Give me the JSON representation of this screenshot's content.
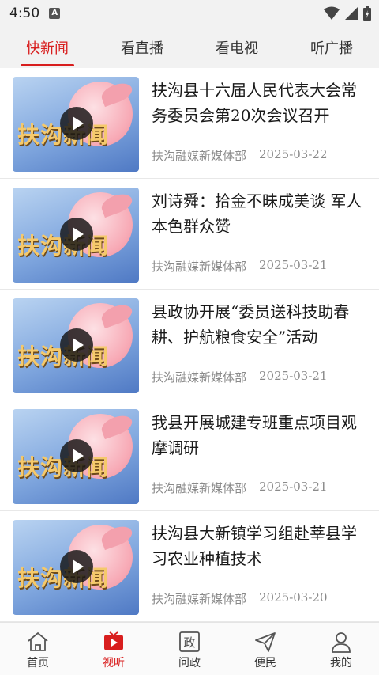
{
  "status_bar": {
    "time": "4:50",
    "badge": "A"
  },
  "top_tabs": [
    {
      "label": "快新闻",
      "active": true
    },
    {
      "label": "看直播",
      "active": false
    },
    {
      "label": "看电视",
      "active": false
    },
    {
      "label": "听广播",
      "active": false
    }
  ],
  "thumbnail_text": "扶沟新闻",
  "news": [
    {
      "title": "扶沟县十六届人民代表大会常务委员会第20次会议召开",
      "source": "扶沟融媒新媒体部",
      "date": "2025-03-22"
    },
    {
      "title": "刘诗舜：拾金不昧成美谈 军人本色群众赞",
      "source": "扶沟融媒新媒体部",
      "date": "2025-03-21"
    },
    {
      "title": "县政协开展“委员送科技助春耕、护航粮食安全”活动",
      "source": "扶沟融媒新媒体部",
      "date": "2025-03-21"
    },
    {
      "title": "我县开展城建专班重点项目观摩调研",
      "source": "扶沟融媒新媒体部",
      "date": "2025-03-21"
    },
    {
      "title": "扶沟县大新镇学习组赴莘县学习农业种植技术",
      "source": "扶沟融媒新媒体部",
      "date": "2025-03-20"
    }
  ],
  "bottom_nav": [
    {
      "label": "首页",
      "icon": "home-icon",
      "active": false
    },
    {
      "label": "视听",
      "icon": "video-play-icon",
      "active": true
    },
    {
      "label": "问政",
      "icon": "zheng-icon",
      "icon_char": "政",
      "active": false
    },
    {
      "label": "便民",
      "icon": "send-icon",
      "active": false
    },
    {
      "label": "我的",
      "icon": "user-icon",
      "active": false
    }
  ],
  "colors": {
    "accent": "#d81e1e",
    "meta_text": "#8a8a8a",
    "tab_bg": "#f2f2f2"
  }
}
